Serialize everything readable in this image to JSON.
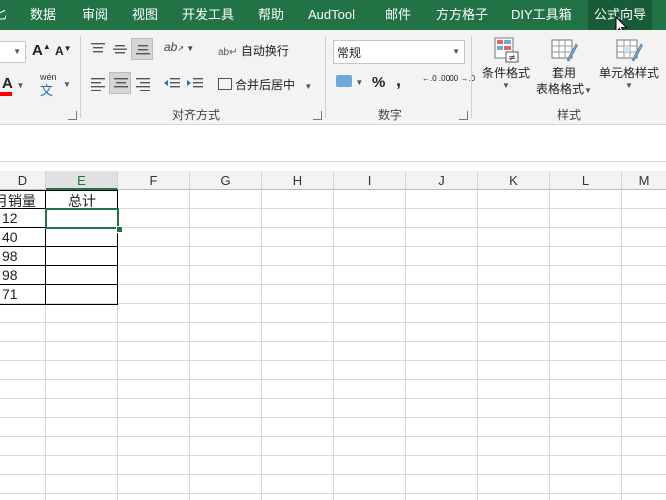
{
  "menu": {
    "items": [
      "匕",
      "数据",
      "审阅",
      "视图",
      "开发工具",
      "帮助",
      "AudTool",
      "邮件",
      "方方格子",
      "DIY工具箱",
      "公式向导"
    ],
    "active_index": 10
  },
  "ribbon": {
    "font": {
      "grow_label": "A",
      "shrink_label": "A",
      "font_color_label": "A",
      "phonetic_top": "wén",
      "phonetic_bottom": "文"
    },
    "alignment": {
      "group_label": "对齐方式",
      "wrap_text": "自动换行",
      "merge_center": "合并后居中",
      "orientation_icon": "ab"
    },
    "number": {
      "group_label": "数字",
      "format_value": "常规",
      "percent": "%",
      "comma": ",",
      "inc_decimal": "←.0 .00",
      "dec_decimal": ".00 →.0"
    },
    "styles": {
      "group_label": "样式",
      "conditional": "条件格式",
      "table_line1": "套用",
      "table_line2": "表格格式",
      "cell_styles": "单元格样式"
    }
  },
  "columns": [
    "D",
    "E",
    "F",
    "G",
    "H",
    "I",
    "J",
    "K",
    "L",
    "M"
  ],
  "selected_column": "E",
  "cells": {
    "d_header": "月销量",
    "e_header": "总计",
    "d_values": [
      "12",
      "40",
      "98",
      "98",
      "71"
    ]
  },
  "colors": {
    "accent": "#217346",
    "menu_active": "#185c37",
    "selection": "#217346",
    "font_color_bar": "#ff0000"
  }
}
